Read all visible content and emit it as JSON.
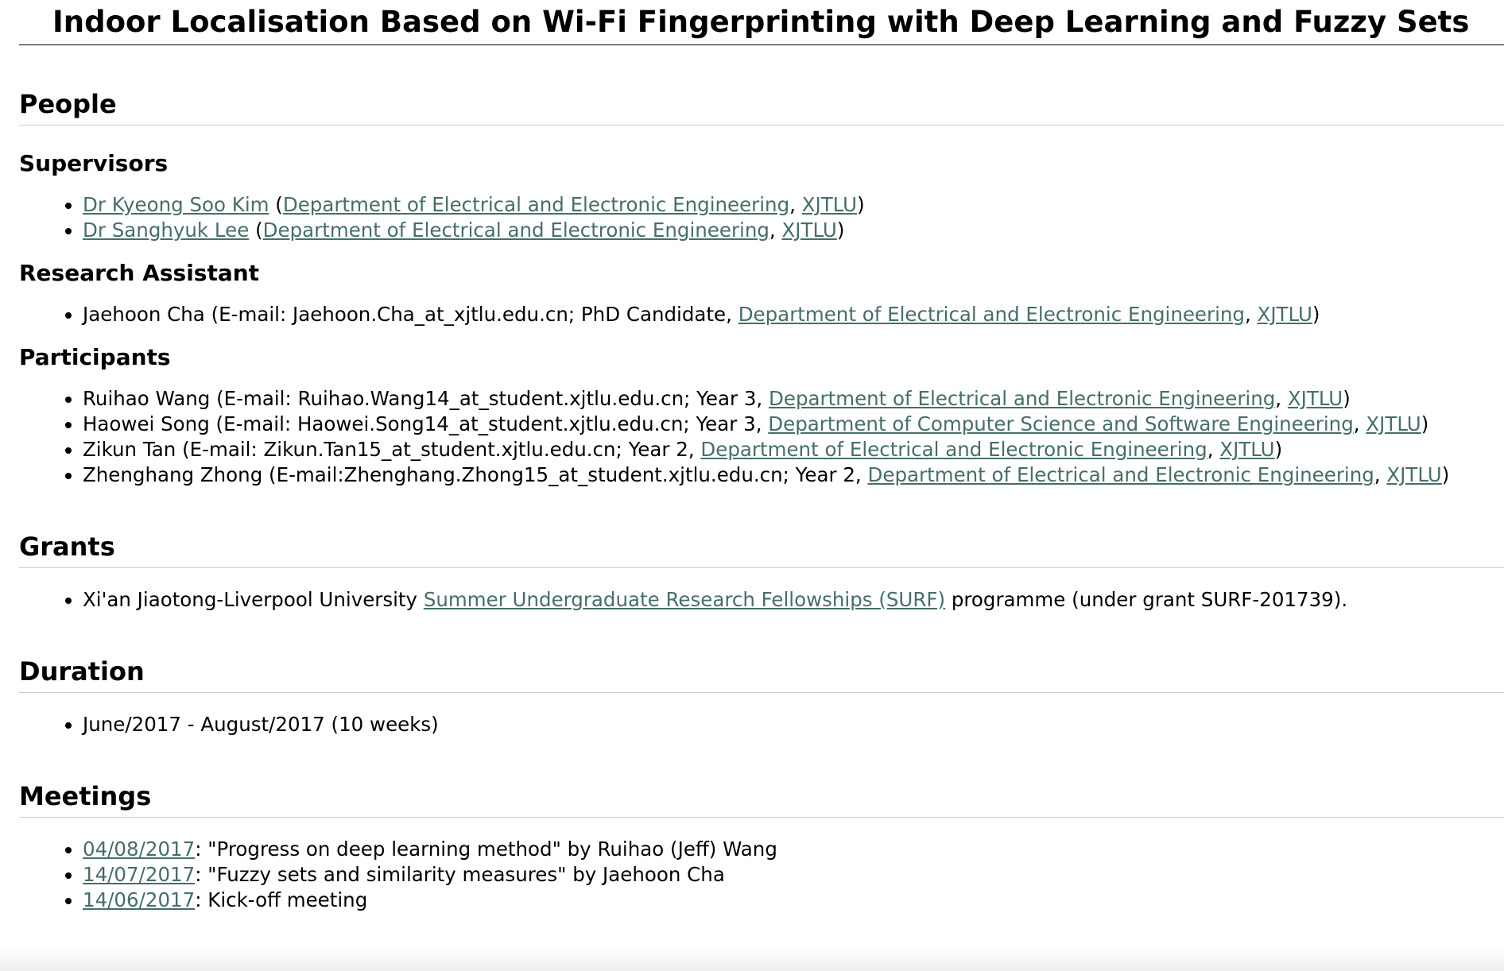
{
  "title": "Indoor Localisation Based on Wi-Fi Fingerprinting with Deep Learning and Fuzzy Sets",
  "people": {
    "heading": "People",
    "supervisors": {
      "heading": "Supervisors",
      "items": [
        {
          "name": "Dr Kyeong Soo Kim",
          "open": " (",
          "dept": "Department of Electrical and Electronic Engineering",
          "sep": ", ",
          "uni": "XJTLU",
          "close": ")"
        },
        {
          "name": "Dr Sanghyuk Lee",
          "open": " (",
          "dept": "Department of Electrical and Electronic Engineering",
          "sep": ", ",
          "uni": "XJTLU",
          "close": ")"
        }
      ]
    },
    "research_assistant": {
      "heading": "Research Assistant",
      "items": [
        {
          "text": "Jaehoon Cha (E-mail: Jaehoon.Cha_at_xjtlu.edu.cn; PhD Candidate, ",
          "dept": "Department of Electrical and Electronic Engineering",
          "sep": ", ",
          "uni": "XJTLU",
          "close": ")"
        }
      ]
    },
    "participants": {
      "heading": "Participants",
      "items": [
        {
          "text": "Ruihao Wang (E-mail: Ruihao.Wang14_at_student.xjtlu.edu.cn; Year 3, ",
          "dept": "Department of Electrical and Electronic Engineering",
          "sep": ", ",
          "uni": "XJTLU",
          "close": ")"
        },
        {
          "text": "Haowei Song (E-mail: Haowei.Song14_at_student.xjtlu.edu.cn; Year 3, ",
          "dept": "Department of Computer Science and Software Engineering",
          "sep": ", ",
          "uni": "XJTLU",
          "close": ")"
        },
        {
          "text": "Zikun Tan (E-mail: Zikun.Tan15_at_student.xjtlu.edu.cn; Year 2, ",
          "dept": "Department of Electrical and Electronic Engineering",
          "sep": ", ",
          "uni": "XJTLU",
          "close": ")"
        },
        {
          "text": "Zhenghang Zhong (E-mail:Zhenghang.Zhong15_at_student.xjtlu.edu.cn; Year 2, ",
          "dept": "Department of Electrical and Electronic Engineering",
          "sep": ", ",
          "uni": "XJTLU",
          "close": ")"
        }
      ]
    }
  },
  "grants": {
    "heading": "Grants",
    "items": [
      {
        "before": "Xi'an Jiaotong-Liverpool University ",
        "link": "Summer Undergraduate Research Fellowships (SURF)",
        "after": " programme (under grant SURF-201739)."
      }
    ]
  },
  "duration": {
    "heading": "Duration",
    "items": [
      {
        "text": "June/2017 - August/2017 (10 weeks)"
      }
    ]
  },
  "meetings": {
    "heading": "Meetings",
    "items": [
      {
        "date": "04/08/2017",
        "desc": ": \"Progress on deep learning method\" by Ruihao (Jeff) Wang"
      },
      {
        "date": "14/07/2017",
        "desc": ": \"Fuzzy sets and similarity measures\" by Jaehoon Cha"
      },
      {
        "date": "14/06/2017",
        "desc": ": Kick-off meeting"
      }
    ]
  },
  "colors": {
    "link": "#466e6a",
    "text": "#000000",
    "rule": "#cccccc"
  }
}
